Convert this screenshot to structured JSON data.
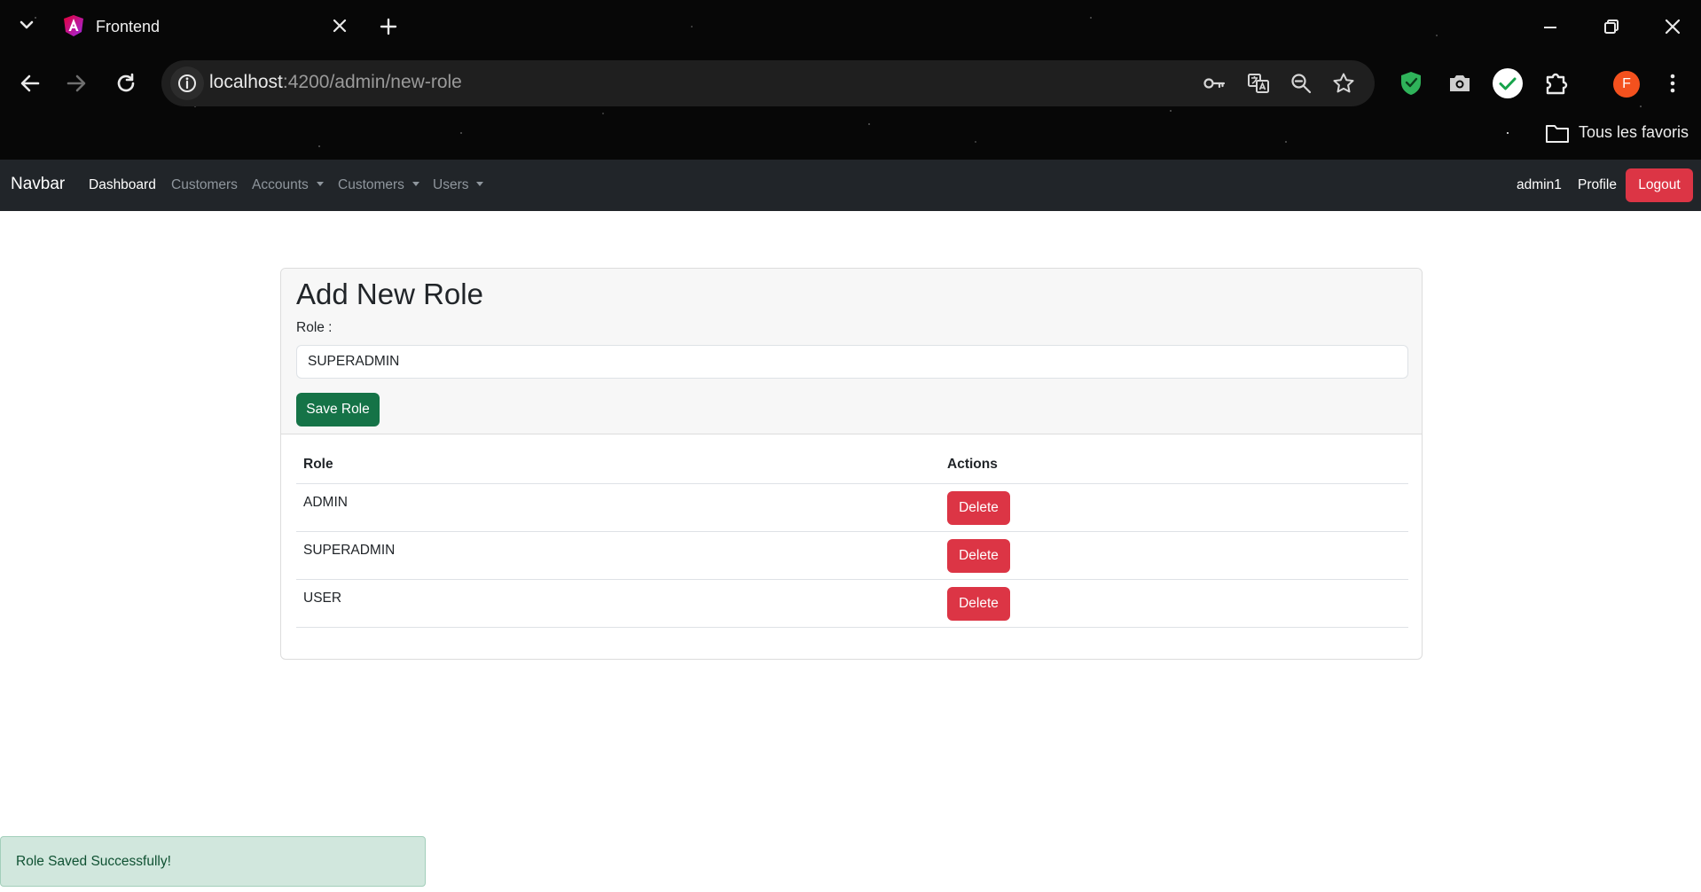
{
  "browser": {
    "tab_title": "Frontend",
    "url_host": "localhost",
    "url_path": ":4200/admin/new-role",
    "bookmarks_label": "Tous les favoris",
    "profile_initial": "F"
  },
  "navbar": {
    "brand": "Navbar",
    "links": [
      {
        "label": "Dashboard",
        "active": true
      },
      {
        "label": "Customers"
      },
      {
        "label": "Accounts",
        "dropdown": true
      },
      {
        "label": "Customers",
        "dropdown": true
      },
      {
        "label": "Users",
        "dropdown": true
      }
    ],
    "username": "admin1",
    "profile_label": "Profile",
    "logout_label": "Logout"
  },
  "form": {
    "title": "Add New Role",
    "role_label": "Role :",
    "role_value": "SUPERADMIN",
    "save_label": "Save Role"
  },
  "table": {
    "headers": [
      "Role",
      "Actions"
    ],
    "rows": [
      {
        "role": "ADMIN",
        "action": "Delete"
      },
      {
        "role": "SUPERADMIN",
        "action": "Delete"
      },
      {
        "role": "USER",
        "action": "Delete"
      }
    ]
  },
  "toast": {
    "message": "Role Saved Successfully!"
  },
  "colors": {
    "navbar_bg": "#212529",
    "danger": "#dc3545",
    "success": "#157347",
    "toast_bg": "#d1e7dd"
  },
  "icons": [
    "chevron-down-icon",
    "angular-logo-icon",
    "close-icon",
    "plus-icon",
    "minimize-icon",
    "restore-icon",
    "back-icon",
    "forward-icon",
    "reload-icon",
    "info-icon",
    "key-icon",
    "translate-icon",
    "zoom-icon",
    "star-icon",
    "shield-extension-icon",
    "camera-extension-icon",
    "check-extension-icon",
    "puzzle-icon",
    "avatar",
    "more-vert-icon",
    "folder-icon"
  ]
}
